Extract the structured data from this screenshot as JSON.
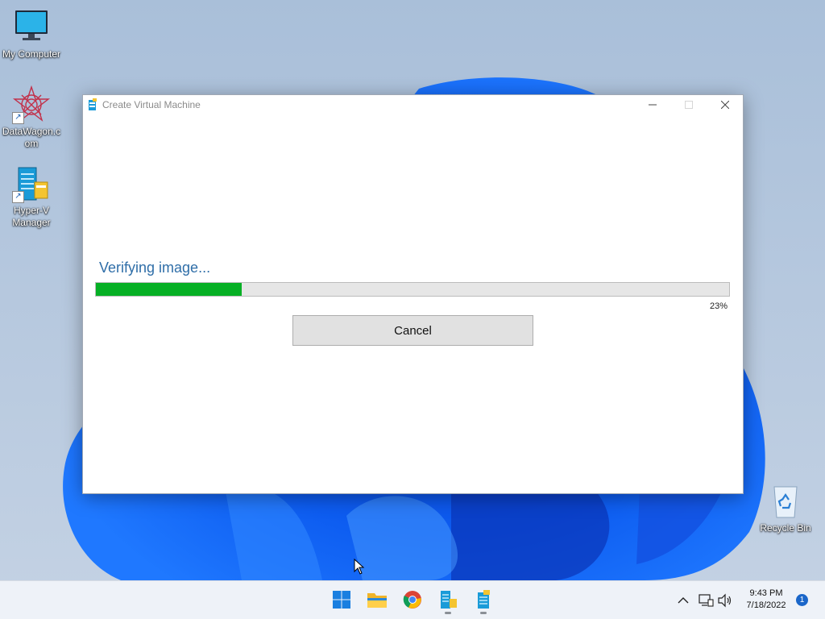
{
  "desktop": {
    "icons": [
      {
        "label": "My Computer",
        "icon": "monitor-icon"
      },
      {
        "label": "DataWagon.com",
        "icon": "datawagon-logo-icon"
      },
      {
        "label": "Hyper-V Manager",
        "icon": "hyperv-icon"
      },
      {
        "label": "Recycle Bin",
        "icon": "recycle-bin-icon"
      }
    ]
  },
  "window": {
    "title": "Create Virtual Machine",
    "status_text": "Verifying image...",
    "progress_percent": 23,
    "progress_label": "23%",
    "cancel_label": "Cancel",
    "progress_color": "#06b025",
    "status_color": "#2f6ea8"
  },
  "taskbar": {
    "apps": [
      "windows-start-icon",
      "file-explorer-icon",
      "chrome-icon",
      "hyperv-manager-icon",
      "vm-setup-icon"
    ],
    "clock": {
      "time": "9:43 PM",
      "date": "7/18/2022"
    },
    "notification_count": "1"
  }
}
